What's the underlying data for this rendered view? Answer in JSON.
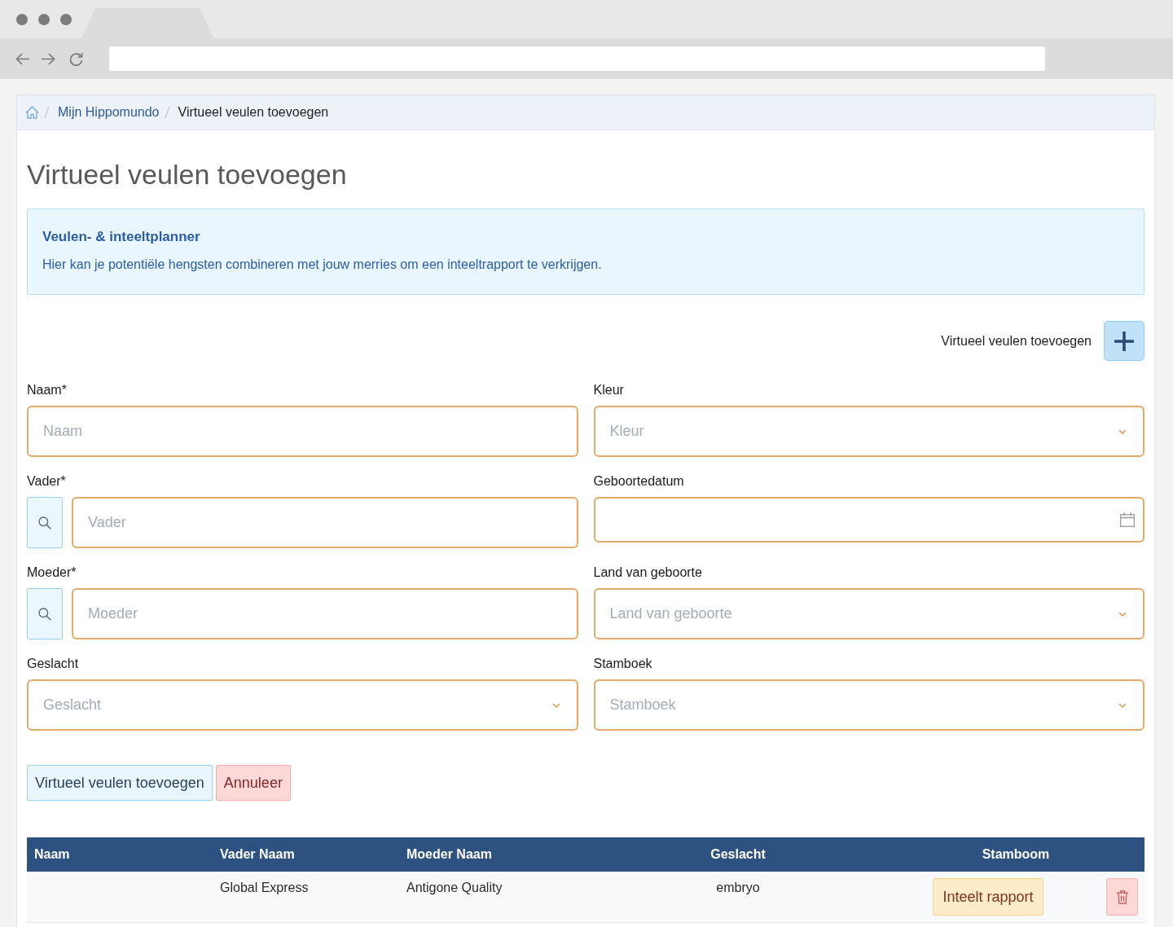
{
  "breadcrumb": [
    {
      "label": "Mijn Hippomundo",
      "current": false
    },
    {
      "label": "Virtueel veulen toevoegen",
      "current": true
    }
  ],
  "page_title": "Virtueel veulen toevoegen",
  "info": {
    "title": "Veulen- & inteeltplanner",
    "text": "Hier kan je potentiële hengsten combineren met jouw merries om een inteeltrapport te verkrijgen."
  },
  "add_action": {
    "label": "Virtueel veulen toevoegen"
  },
  "form": {
    "fields": [
      {
        "label": "Naam*",
        "kind": "text",
        "placeholder": "Naam"
      },
      {
        "label": "Kleur",
        "kind": "select",
        "placeholder": "Kleur"
      },
      {
        "label": "Vader*",
        "kind": "search",
        "placeholder": "Vader"
      },
      {
        "label": "Geboortedatum",
        "kind": "date"
      },
      {
        "label": "Moeder*",
        "kind": "search",
        "placeholder": "Moeder"
      },
      {
        "label": "Land van geboorte",
        "kind": "select",
        "placeholder": "Land van geboorte"
      },
      {
        "label": "Geslacht",
        "kind": "select",
        "placeholder": "Geslacht"
      },
      {
        "label": "Stamboek",
        "kind": "select",
        "placeholder": "Stamboek"
      }
    ]
  },
  "buttons": [
    {
      "label": "Virtueel veulen toevoegen",
      "kind": "submit"
    },
    {
      "label": "Annuleer",
      "kind": "cancel"
    }
  ],
  "table": {
    "columns": [
      "Naam",
      "Vader Naam",
      "Moeder Naam",
      "Geslacht",
      "Stamboom"
    ],
    "rows": [
      {
        "vader_naam": "Global Express",
        "moeder_naam": "Antigone Quality",
        "geslacht": "embryo",
        "report_button": "Inteelt rapport"
      }
    ]
  }
}
